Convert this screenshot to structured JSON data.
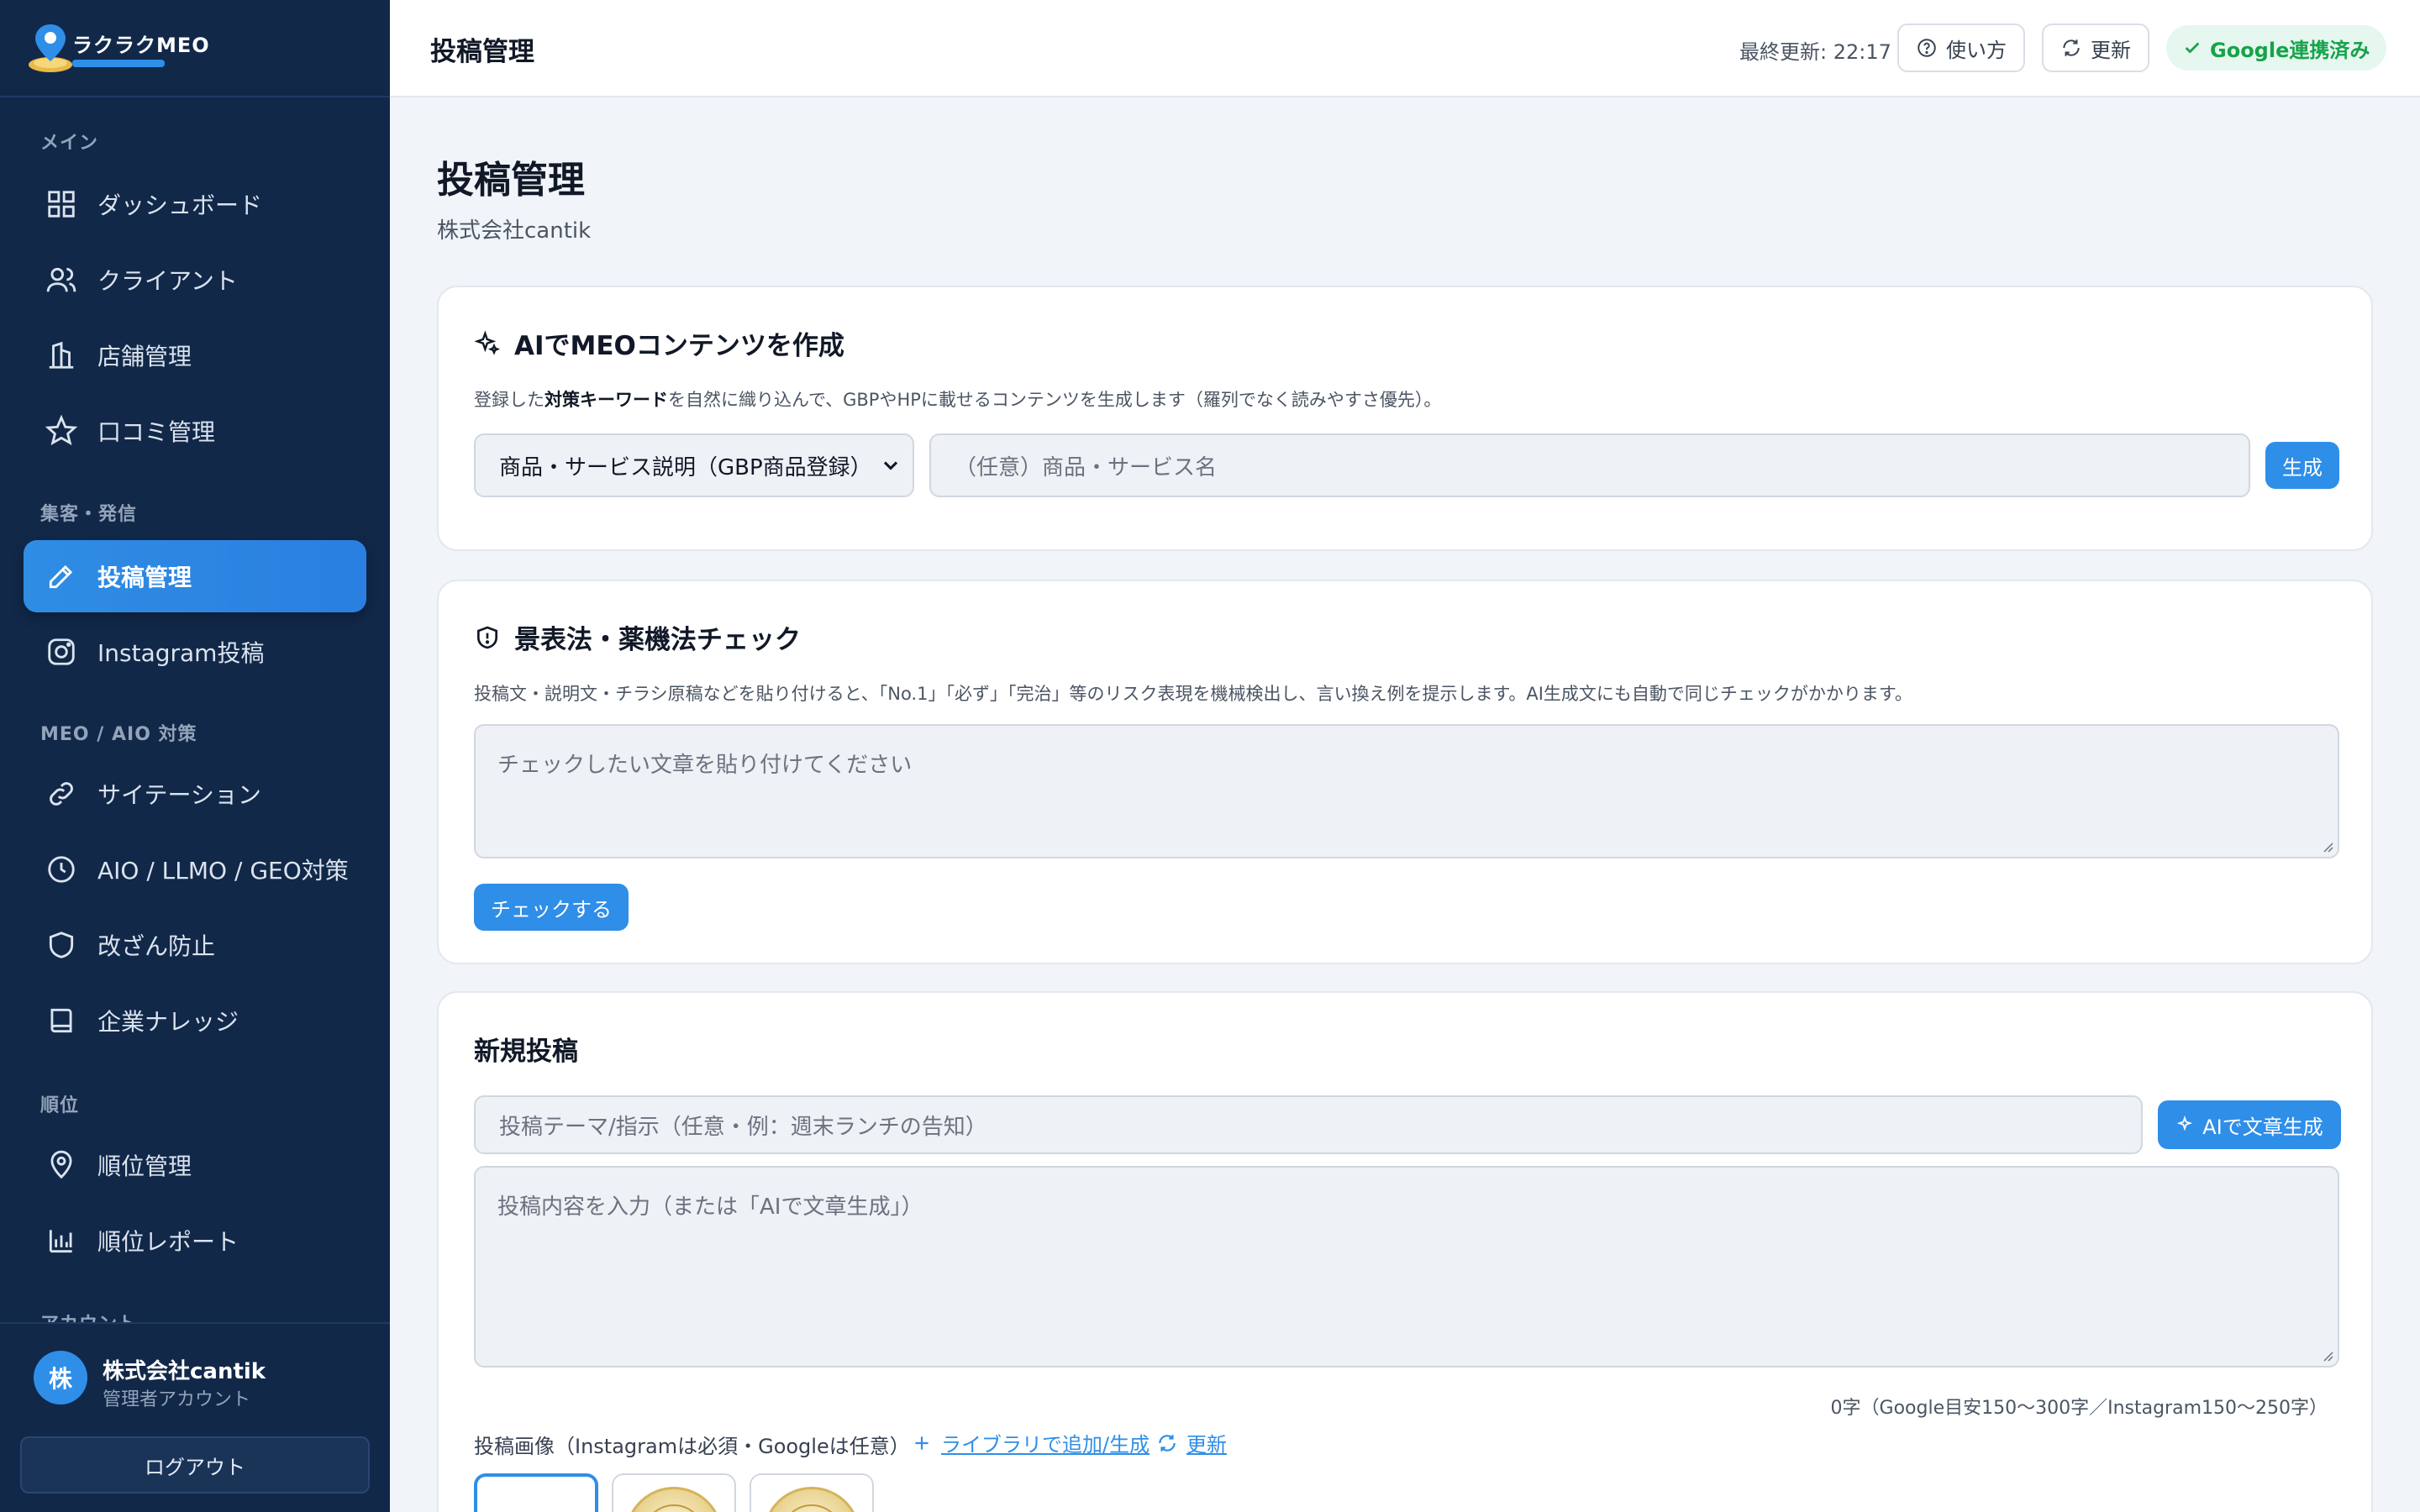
{
  "app": {
    "logo_text": "ラクラクMEO"
  },
  "sidebar": {
    "sections": [
      {
        "label": "メイン"
      },
      {
        "label": "集客・発信"
      },
      {
        "label": "MEO / AIO 対策"
      },
      {
        "label": "順位"
      },
      {
        "label": "アカウント"
      }
    ],
    "items": [
      {
        "label": "ダッシュボード",
        "icon": "grid-icon"
      },
      {
        "label": "クライアント",
        "icon": "users-icon"
      },
      {
        "label": "店舗管理",
        "icon": "building-icon"
      },
      {
        "label": "口コミ管理",
        "icon": "star-icon"
      },
      {
        "label": "投稿管理",
        "icon": "pencil-icon",
        "active": true
      },
      {
        "label": "Instagram投稿",
        "icon": "instagram-icon"
      },
      {
        "label": "サイテーション",
        "icon": "link-icon"
      },
      {
        "label": "AIO / LLMO / GEO対策",
        "icon": "clock-icon"
      },
      {
        "label": "改ざん防止",
        "icon": "shield-icon"
      },
      {
        "label": "企業ナレッジ",
        "icon": "book-icon"
      },
      {
        "label": "順位管理",
        "icon": "map-pin-icon"
      },
      {
        "label": "順位レポート",
        "icon": "bar-chart-icon"
      }
    ],
    "user": {
      "avatar_initial": "株",
      "name": "株式会社cantik",
      "role": "管理者アカウント"
    },
    "logout_label": "ログアウト"
  },
  "header": {
    "title": "投稿管理",
    "last_updated": "最終更新: 22:17",
    "help_label": "使い方",
    "refresh_label": "更新",
    "google_status": "Google連携済み"
  },
  "main": {
    "title": "投稿管理",
    "subtitle": "株式会社cantik",
    "ai_content": {
      "title": "AIでMEOコンテンツを作成",
      "desc_prefix": "登録した",
      "desc_bold": "対策キーワード",
      "desc_suffix": "を自然に織り込んで、GBPやHPに載せるコンテンツを生成します（羅列でなく読みやすさ優先）。",
      "select_value": "商品・サービス説明（GBP商品登録）",
      "name_placeholder": "（任意）商品・サービス名",
      "generate_label": "生成"
    },
    "compliance": {
      "title": "景表法・薬機法チェック",
      "desc": "投稿文・説明文・チラシ原稿などを貼り付けると、「No.1」「必ず」「完治」等のリスク表現を機械検出し、言い換え例を提示します。AI生成文にも自動で同じチェックがかかります。",
      "textarea_placeholder": "チェックしたい文章を貼り付けてください",
      "check_label": "チェックする"
    },
    "new_post": {
      "title": "新規投稿",
      "theme_placeholder": "投稿テーマ/指示（任意・例：週末ランチの告知）",
      "ai_generate_label": "AIで文章生成",
      "content_placeholder": "投稿内容を入力（または「AIで文章生成」）",
      "char_count": "0字（Google目安150〜300字／Instagram150〜250字）",
      "image_label": "投稿画像（Instagramは必須・Googleは任意）",
      "library_label": "ライブラリで追加/生成",
      "image_refresh_label": "更新"
    }
  },
  "colors": {
    "sidebar_bg": "#112849",
    "accent": "#2f8ee8",
    "success": "#16a34a",
    "page_bg": "#f1f4f8"
  }
}
